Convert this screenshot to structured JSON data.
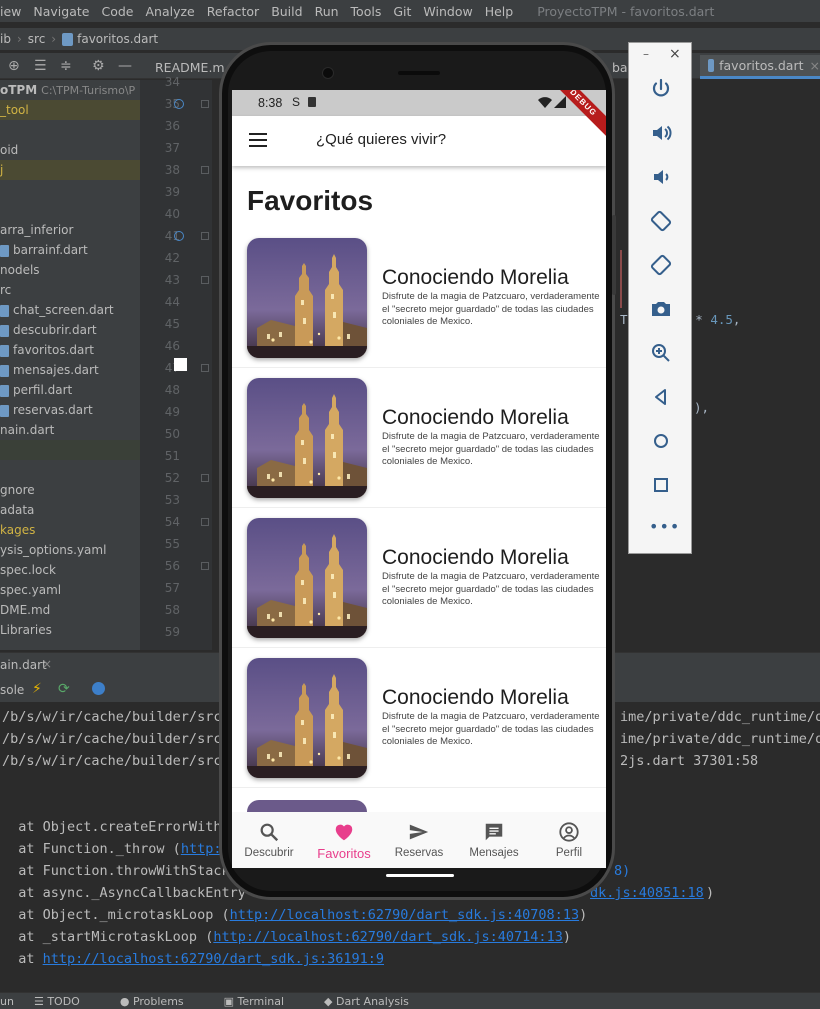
{
  "ide": {
    "menu": [
      "iew",
      "Navigate",
      "Code",
      "Analyze",
      "Refactor",
      "Build",
      "Run",
      "Tools",
      "Git",
      "Window",
      "Help"
    ],
    "project_title": "ProyectoTPM - favoritos.dart",
    "breadcrumb": [
      "ib",
      "src",
      "favoritos.dart"
    ],
    "editor_tabs": [
      "README.m",
      "bar",
      "favoritos.dart"
    ],
    "project_tree": [
      {
        "label": "oTPM",
        "extra": "C:\\TPM-Turismo\\P",
        "style": "bold"
      },
      {
        "label": "_tool",
        "style": "yellow"
      },
      {
        "label": "",
        "style": "plain"
      },
      {
        "label": "oid",
        "style": "plain"
      },
      {
        "label": "j",
        "style": "yellow"
      },
      {
        "label": "",
        "style": "plain"
      },
      {
        "label": "",
        "style": "plain"
      },
      {
        "label": "arra_inferior",
        "style": "plain"
      },
      {
        "label": "barrainf.dart",
        "style": "file"
      },
      {
        "label": "nodels",
        "style": "plain"
      },
      {
        "label": "rc",
        "style": "plain"
      },
      {
        "label": "chat_screen.dart",
        "style": "file"
      },
      {
        "label": "descubrir.dart",
        "style": "file"
      },
      {
        "label": "favoritos.dart",
        "style": "file"
      },
      {
        "label": "mensajes.dart",
        "style": "file"
      },
      {
        "label": "perfil.dart",
        "style": "file"
      },
      {
        "label": "reservas.dart",
        "style": "file"
      },
      {
        "label": "nain.dart",
        "style": "plain"
      },
      {
        "label": "",
        "style": "green"
      },
      {
        "label": "",
        "style": "plain"
      },
      {
        "label": "gnore",
        "style": "plain"
      },
      {
        "label": "adata",
        "style": "plain"
      },
      {
        "label": "kages",
        "style": "yellowtext"
      },
      {
        "label": "ysis_options.yaml",
        "style": "plain"
      },
      {
        "label": "spec.lock",
        "style": "plain"
      },
      {
        "label": "spec.yaml",
        "style": "plain"
      },
      {
        "label": "DME.md",
        "style": "plain"
      },
      {
        "label": " Libraries",
        "style": "plain"
      }
    ],
    "line_numbers": [
      "34",
      "35",
      "36",
      "37",
      "38",
      "39",
      "40",
      "41",
      "42",
      "43",
      "44",
      "45",
      "46",
      "47",
      "48",
      "49",
      "50",
      "51",
      "52",
      "53",
      "54",
      "55",
      "56",
      "57",
      "58",
      "59"
    ],
    "code_fragment_1": {
      "pre": "T",
      "mid": "ntSize! * ",
      "num": "4.5",
      "post": ","
    },
    "code_fragment_2": "),",
    "file_tab": "ain.dart",
    "console_tab": "sole",
    "console_lines": [
      {
        "text": "/b/s/w/ir/cache/builder/src",
        "tail": "ime/private/ddc_runtime/op"
      },
      {
        "text": "/b/s/w/ir/cache/builder/src",
        "tail": "ime/private/ddc_runtime/op"
      },
      {
        "text": "/b/s/w/ir/cache/builder/src",
        "tail": "2js.dart 37301:58"
      }
    ],
    "stack": [
      {
        "prefix": "  at Object.createErrorWith",
        "link": "",
        "suffix": ""
      },
      {
        "prefix": "  at Function._throw (",
        "link": "http:",
        "suffix": ""
      },
      {
        "prefix": "  at Function.throwWithStack",
        "link": "",
        "suffix": "8)"
      },
      {
        "prefix": "  at async._AsyncCallbackEntry",
        "link": "dk.js:40851:18",
        "suffix": ")"
      },
      {
        "prefix": "  at Object._microtaskLoop (",
        "link": "http://localhost:62790/dart_sdk.js:40708:13",
        "suffix": ")"
      },
      {
        "prefix": "  at _startMicrotaskLoop (",
        "link": "http://localhost:62790/dart_sdk.js:40714:13",
        "suffix": ")"
      },
      {
        "prefix": "  at ",
        "link": "http://localhost:62790/dart_sdk.js:36191:9",
        "suffix": ""
      }
    ],
    "bottom_tools": [
      "un",
      "TODO",
      "Problems",
      "Terminal",
      "Dart Analysis"
    ]
  },
  "phone": {
    "status_time": "8:38",
    "debug_label": "DEBUG",
    "app_title": "¿Qué quieres vivir?",
    "page_title": "Favoritos",
    "cards": [
      {
        "title": "Conociendo Morelia",
        "desc": "Disfrute de la magia de Patzcuaro, verdaderamente el \"secreto mejor guardado\" de todas las ciudades coloniales de Mexico."
      },
      {
        "title": "Conociendo Morelia",
        "desc": "Disfrute de la magia de Patzcuaro, verdaderamente el \"secreto mejor guardado\" de todas las ciudades coloniales de Mexico."
      },
      {
        "title": "Conociendo Morelia",
        "desc": "Disfrute de la magia de Patzcuaro, verdaderamente el \"secreto mejor guardado\" de todas las ciudades coloniales de Mexico."
      },
      {
        "title": "Conociendo Morelia",
        "desc": "Disfrute de la magia de Patzcuaro, verdaderamente el \"secreto mejor guardado\" de todas las ciudades coloniales de Mexico."
      }
    ],
    "nav": [
      {
        "label": "Descubrir",
        "icon": "search-icon"
      },
      {
        "label": "Favoritos",
        "icon": "heart-icon",
        "active": true
      },
      {
        "label": "Reservas",
        "icon": "send-icon"
      },
      {
        "label": "Mensajes",
        "icon": "message-icon"
      },
      {
        "label": "Perfil",
        "icon": "account-icon"
      }
    ],
    "accent_color": "#e83e8c"
  }
}
